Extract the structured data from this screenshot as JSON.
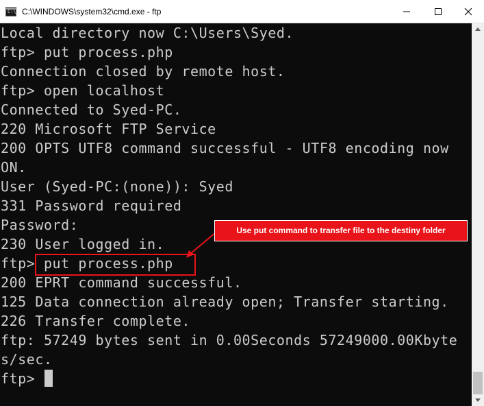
{
  "window": {
    "title": "C:\\WINDOWS\\system32\\cmd.exe - ftp",
    "icon": "cmd-icon",
    "buttons": {
      "minimize": "minimize-icon",
      "maximize": "maximize-icon",
      "close": "close-icon"
    }
  },
  "console": {
    "lines": [
      "Local directory now C:\\Users\\Syed.",
      "ftp> put process.php",
      "Connection closed by remote host.",
      "ftp> open localhost",
      "Connected to Syed-PC.",
      "220 Microsoft FTP Service",
      "200 OPTS UTF8 command successful - UTF8 encoding now",
      "ON.",
      "User (Syed-PC:(none)): Syed",
      "331 Password required",
      "Password:",
      "230 User logged in.",
      "ftp> put process.php",
      "200 EPRT command successful.",
      "125 Data connection already open; Transfer starting.",
      "226 Transfer complete.",
      "ftp: 57249 bytes sent in 0.00Seconds 57249000.00Kbyte",
      "s/sec.",
      "ftp> "
    ]
  },
  "annotation": {
    "text": "Use put command to transfer file to the destiny folder",
    "color": "#e8141a"
  },
  "colors": {
    "console_bg": "#0c0c0c",
    "console_fg": "#cccccc",
    "titlebar_bg": "#ffffff"
  }
}
